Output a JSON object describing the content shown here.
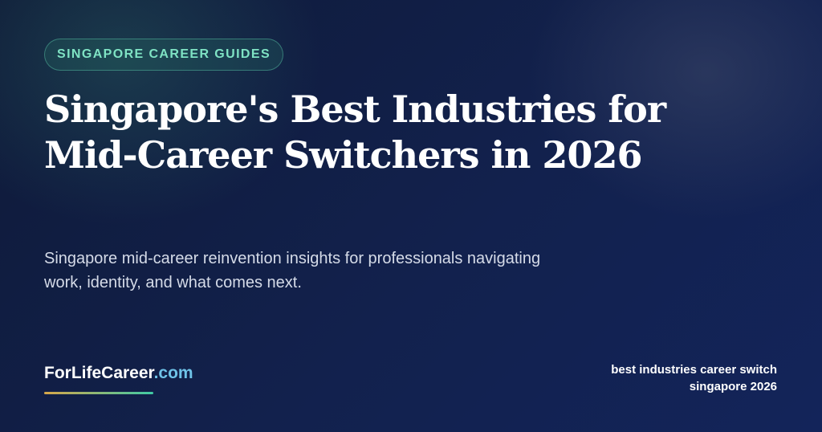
{
  "badge": {
    "label": "SINGAPORE CAREER GUIDES"
  },
  "title": "Singapore's Best Industries for Mid-Career Switchers in 2026",
  "subtitle": "Singapore mid-career reinvention insights for professionals navigating work, identity, and what comes next.",
  "brand": {
    "name": "ForLifeCareer",
    "tld": ".com"
  },
  "keywords": {
    "line1": "best industries career switch",
    "line2": "singapore 2026"
  },
  "colors": {
    "badge_text": "#7fe3c4",
    "brand_tld": "#6fc3e8",
    "underline_start": "#d7a74a",
    "underline_end": "#3fcaa5",
    "background": "#12214d"
  }
}
